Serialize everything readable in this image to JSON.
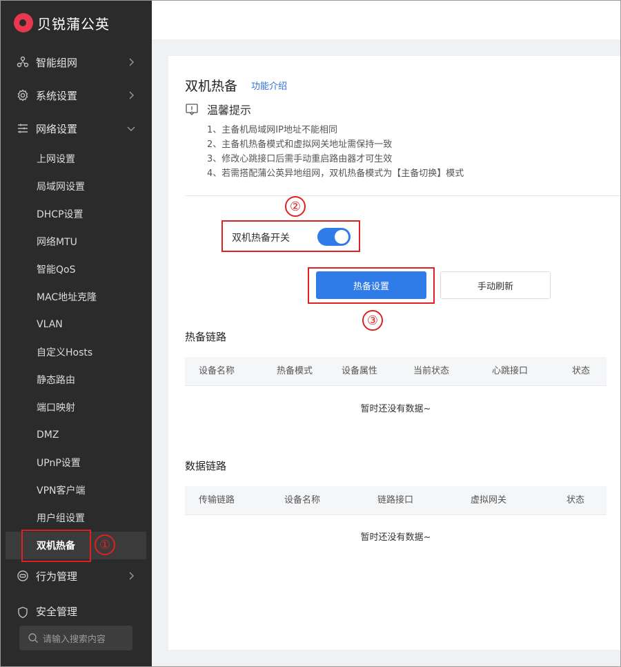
{
  "brand": {
    "name": "贝锐蒲公英"
  },
  "sidebar": {
    "groups": [
      {
        "label": "智能组网",
        "icon": "network-icon"
      },
      {
        "label": "系统设置",
        "icon": "gear-icon"
      },
      {
        "label": "网络设置",
        "icon": "sliders-icon"
      },
      {
        "label": "行为管理",
        "icon": "behavior-icon"
      },
      {
        "label": "安全管理",
        "icon": "shield-icon"
      }
    ],
    "items": [
      {
        "label": "上网设置"
      },
      {
        "label": "局域网设置"
      },
      {
        "label": "DHCP设置"
      },
      {
        "label": "网络MTU"
      },
      {
        "label": "智能QoS"
      },
      {
        "label": "MAC地址克隆"
      },
      {
        "label": "VLAN"
      },
      {
        "label": "自定义Hosts"
      },
      {
        "label": "静态路由"
      },
      {
        "label": "端口映射"
      },
      {
        "label": "DMZ"
      },
      {
        "label": "UPnP设置"
      },
      {
        "label": "VPN客户端"
      },
      {
        "label": "用户组设置"
      },
      {
        "label": "双机热备"
      }
    ],
    "search_placeholder": "请输入搜索内容"
  },
  "main": {
    "title": "双机热备",
    "title_link": "功能介绍",
    "tip_title": "温馨提示",
    "tips": [
      "1、主备机局域网IP地址不能相同",
      "2、主备机热备模式和虚拟网关地址需保持一致",
      "3、修改心跳接口后需手动重启路由器才可生效",
      "4、若需搭配蒲公英异地组网，双机热备模式为【主备切换】模式"
    ],
    "switch_label": "双机热备开关",
    "switch_on": true,
    "btn_settings": "热备设置",
    "btn_refresh": "手动刷新",
    "hot_link": {
      "title": "热备链路",
      "columns": [
        "设备名称",
        "热备模式",
        "设备属性",
        "当前状态",
        "心跳接口",
        "状态"
      ],
      "empty": "暂时还没有数据~"
    },
    "data_link": {
      "title": "数据链路",
      "columns": [
        "传输链路",
        "设备名称",
        "链路接口",
        "虚拟网关",
        "状态"
      ],
      "empty": "暂时还没有数据~"
    }
  },
  "annotations": {
    "mark1": "①",
    "mark2": "②",
    "mark3": "③"
  },
  "colors": {
    "accent": "#2f7be8",
    "sidebar": "#2b2b2b",
    "annotation": "#e02020",
    "logo": "#e8374f"
  }
}
